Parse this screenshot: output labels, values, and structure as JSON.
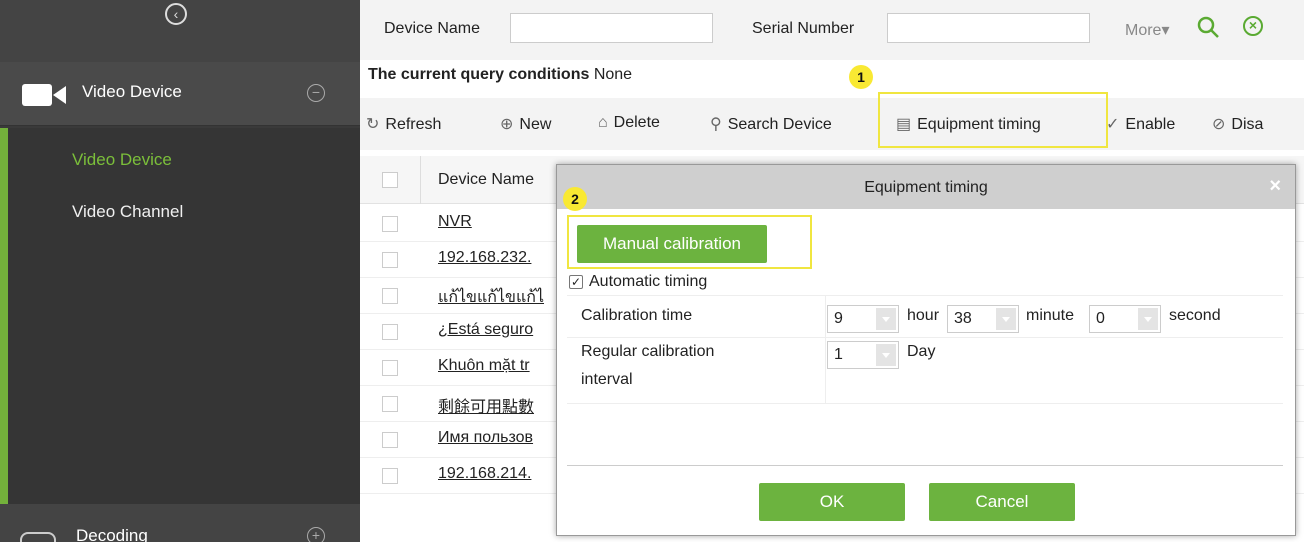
{
  "sidebar": {
    "section_title": "Video Device",
    "items": [
      {
        "label": "Video Device"
      },
      {
        "label": "Video Channel"
      }
    ],
    "footer_title": "Decoding"
  },
  "search": {
    "device_name_label": "Device Name",
    "device_name_value": "",
    "serial_label": "Serial Number",
    "serial_value": "",
    "more_label": "More▾"
  },
  "query": {
    "label": "The current query conditions",
    "value": "None"
  },
  "toolbar": {
    "refresh": "Refresh",
    "new": "New",
    "delete": "Delete",
    "search_device": "Search Device",
    "equipment_timing": "Equipment timing",
    "enable": "Enable",
    "disable": "Disa"
  },
  "table": {
    "header": "Device Name",
    "rows": [
      "NVR",
      "192.168.232.",
      "แก้ไขแก้ไขแก้ไ",
      "¿Está seguro",
      "Khuôn mặt tr",
      "剩餘可用點數",
      "Имя пользов",
      "192.168.214."
    ]
  },
  "dialog": {
    "title": "Equipment timing",
    "close": "×",
    "manual_calibration": "Manual calibration",
    "automatic_timing": "Automatic timing",
    "automatic_timing_checked": true,
    "calibration_time_label": "Calibration time",
    "hour_value": "9",
    "hour_label": "hour",
    "minute_value": "38",
    "minute_label": "minute",
    "second_value": "0",
    "second_label": "second",
    "interval_label_1": "Regular calibration",
    "interval_label_2": "interval",
    "interval_value": "1",
    "interval_unit": "Day",
    "ok": "OK",
    "cancel": "Cancel"
  },
  "annotations": {
    "step1": "1",
    "step2": "2"
  },
  "colors": {
    "accent_green": "#6cb33f",
    "highlight_yellow": "#f0e640"
  }
}
